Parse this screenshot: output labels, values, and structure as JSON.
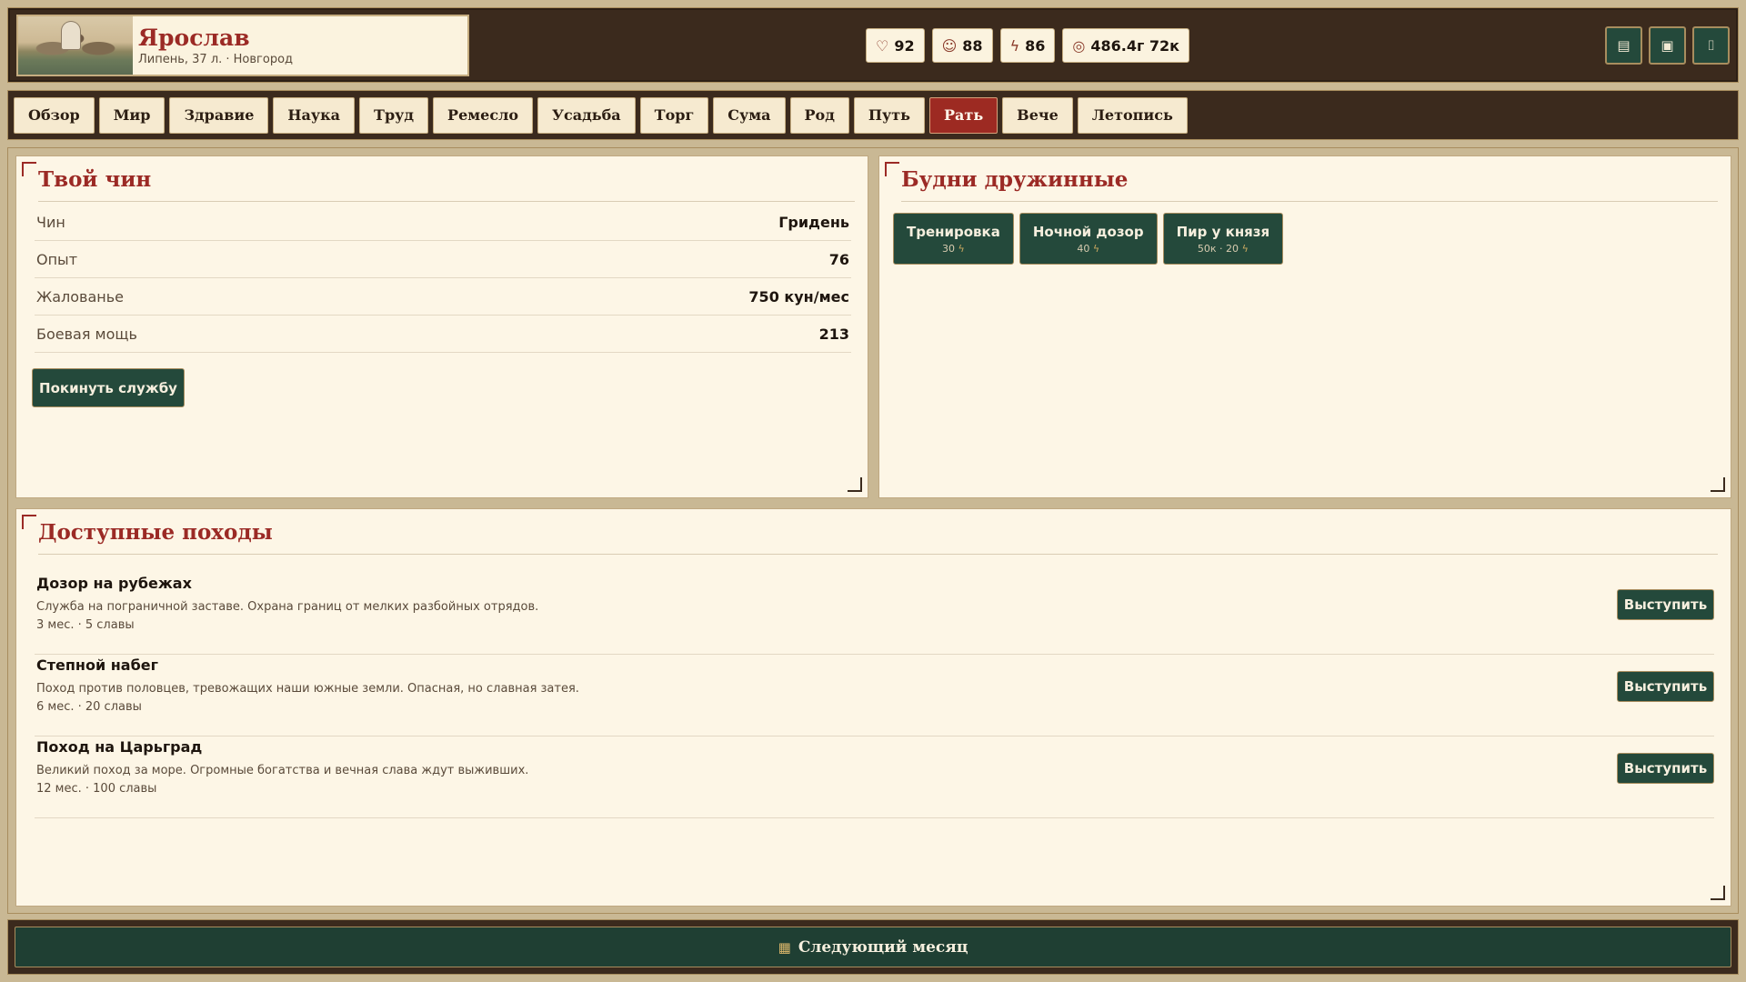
{
  "profile": {
    "name": "Ярослав",
    "subtitle": "Липень, 37 л. · Новгород"
  },
  "stats": [
    {
      "icon": "heart-icon",
      "glyph": "♡",
      "value": "92"
    },
    {
      "icon": "smile-icon",
      "glyph": "☺",
      "value": "88"
    },
    {
      "icon": "bolt-icon",
      "glyph": "ϟ",
      "value": "86"
    },
    {
      "icon": "coins-icon",
      "glyph": "◎",
      "value": "486.4г 72к"
    }
  ],
  "header_buttons": [
    {
      "icon": "document-icon",
      "glyph": "▤"
    },
    {
      "icon": "save-icon",
      "glyph": "▣"
    },
    {
      "icon": "bookmark-icon",
      "glyph": "⌷"
    }
  ],
  "tabs": [
    "Обзор",
    "Мир",
    "Здравие",
    "Наука",
    "Труд",
    "Ремесло",
    "Усадьба",
    "Торг",
    "Сума",
    "Род",
    "Путь",
    "Рать",
    "Вече",
    "Летопись"
  ],
  "active_tab": "Рать",
  "rank_panel": {
    "title": "Твой чин",
    "rows": [
      {
        "label": "Чин",
        "value": "Гридень"
      },
      {
        "label": "Опыт",
        "value": "76"
      },
      {
        "label": "Жалованье",
        "value": "750 кун/мес"
      },
      {
        "label": "Боевая мощь",
        "value": "213"
      }
    ],
    "leave_label": "Покинуть службу"
  },
  "duty_panel": {
    "title": "Будни дружинные",
    "actions": [
      {
        "label": "Тренировка",
        "cost": "30"
      },
      {
        "label": "Ночной дозор",
        "cost": "40"
      },
      {
        "label": "Пир у князя",
        "cost": "50к · 20"
      }
    ]
  },
  "campaigns_panel": {
    "title": "Доступные походы",
    "button_label": "Выступить",
    "items": [
      {
        "name": "Дозор на рубежах",
        "desc": "Служба на пограничной заставе. Охрана границ от мелких разбойных отрядов.",
        "meta": "3 мес. · 5 славы"
      },
      {
        "name": "Степной набег",
        "desc": "Поход против половцев, тревожащих наши южные земли. Опасная, но славная затея.",
        "meta": "6 мес. · 20 славы"
      },
      {
        "name": "Поход на Царьград",
        "desc": "Великий поход за море. Огромные богатства и вечная слава ждут выживших.",
        "meta": "12 мес. · 100 славы"
      }
    ]
  },
  "footer": {
    "next_label": "Следующий месяц"
  },
  "colors": {
    "accent": "#9b2a25",
    "primary": "#24493b",
    "frame": "#3b2a1d",
    "paper": "#fdf6e6"
  }
}
